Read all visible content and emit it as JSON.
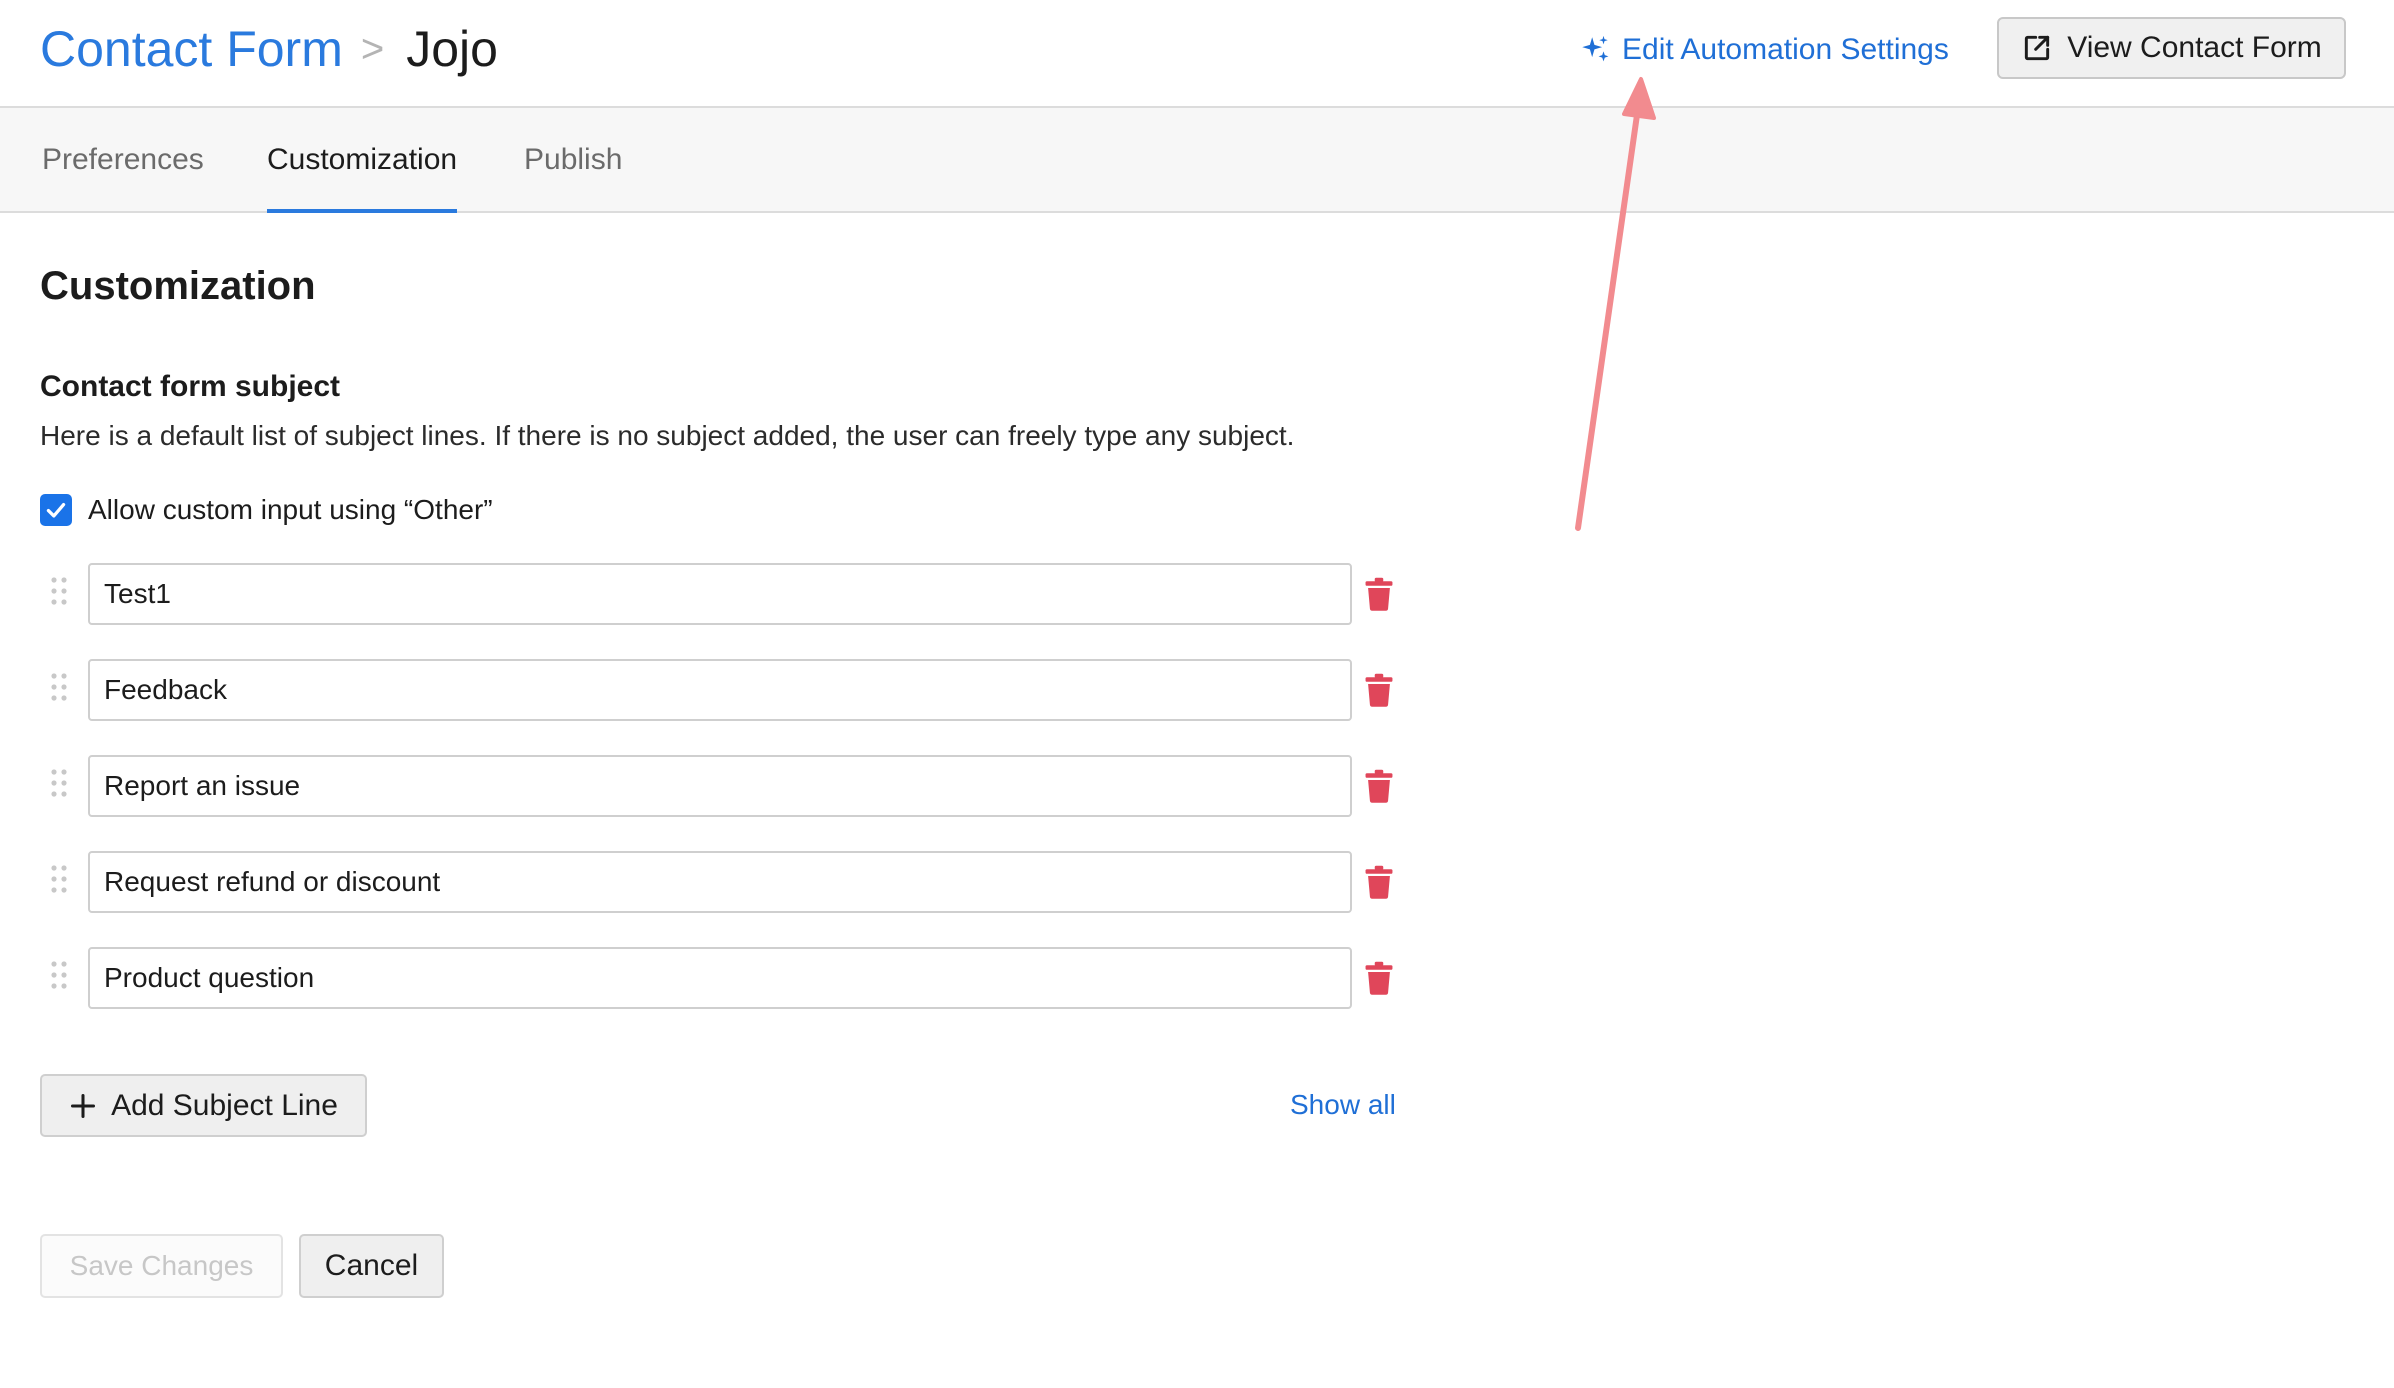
{
  "header": {
    "breadcrumb_link": "Contact Form",
    "breadcrumb_separator": ">",
    "breadcrumb_current": "Jojo",
    "automation_link": "Edit Automation Settings",
    "view_button": "View Contact Form"
  },
  "tabs": [
    {
      "label": "Preferences"
    },
    {
      "label": "Customization",
      "active": true
    },
    {
      "label": "Publish"
    }
  ],
  "main": {
    "section_title": "Customization",
    "subject_title": "Contact form subject",
    "description": "Here is a default list of subject lines. If there is no subject added, the user can freely type any subject.",
    "allow_custom": {
      "label": "Allow custom input using “Other”",
      "checked": true
    },
    "subjects": [
      {
        "value": "Test1"
      },
      {
        "value": "Feedback"
      },
      {
        "value": "Report an issue"
      },
      {
        "value": "Request refund or discount"
      },
      {
        "value": "Product question"
      }
    ],
    "add_button": "Add Subject Line",
    "show_all": "Show all",
    "save_button": "Save Changes",
    "cancel_button": "Cancel"
  },
  "icons": {
    "automation": "sparkle-icon",
    "view": "external-link-icon",
    "drag": "drag-handle-icon",
    "delete": "trash-icon",
    "add": "plus-icon",
    "checkbox": "checkmark-icon"
  },
  "colors": {
    "accent": "#1a73e8",
    "link": "#1f6fd6",
    "delete": "#e0465a",
    "annotation_arrow": "#f28b8f"
  }
}
